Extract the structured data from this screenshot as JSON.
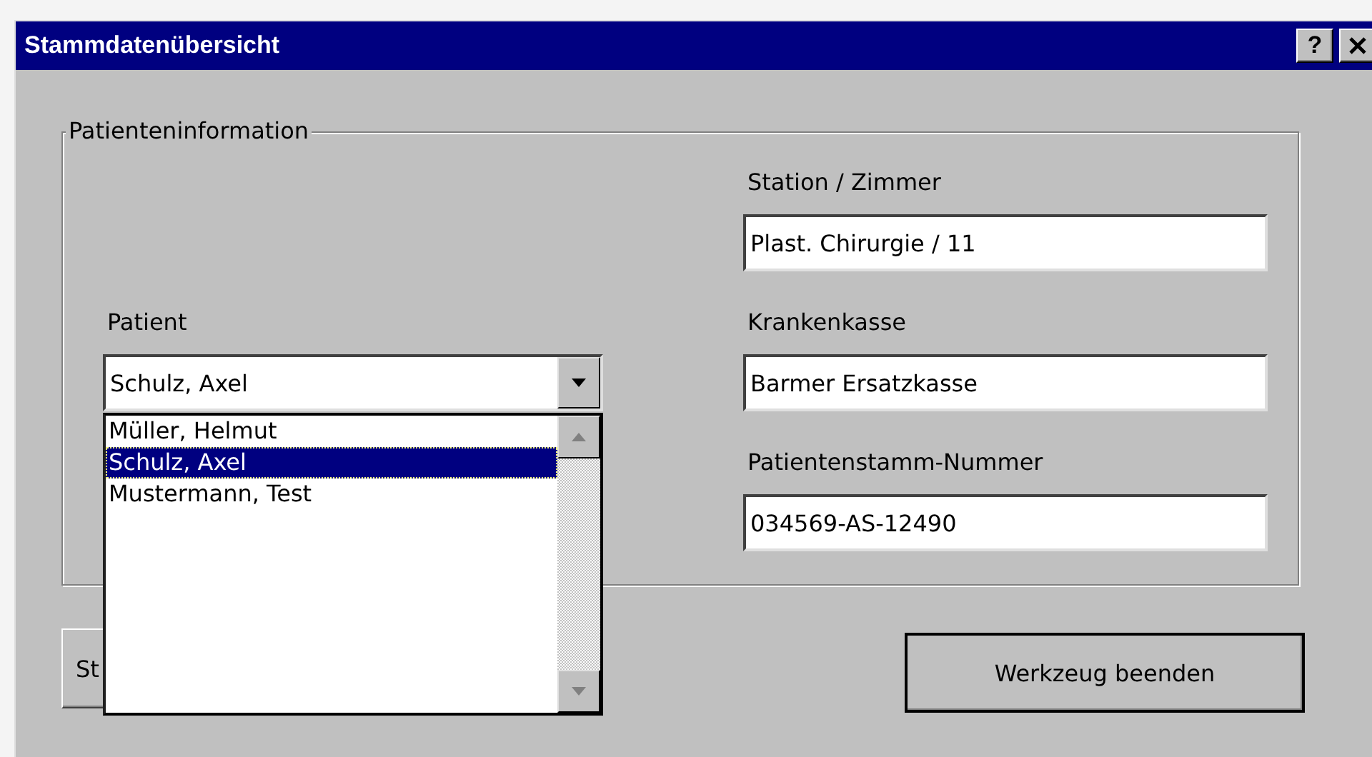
{
  "window": {
    "title": "Stammdatenübersicht",
    "help_label": "?"
  },
  "group": {
    "legend": "Patienteninformation"
  },
  "patient": {
    "label": "Patient",
    "value": "Schulz, Axel",
    "expanded": true,
    "options": [
      {
        "label": "Müller, Helmut",
        "selected": false
      },
      {
        "label": "Schulz, Axel",
        "selected": true
      },
      {
        "label": "Mustermann, Test",
        "selected": false
      }
    ]
  },
  "fields": [
    {
      "label": "Station / Zimmer",
      "value": "Plast. Chirurgie / 11"
    },
    {
      "label": "Krankenkasse",
      "value": "Barmer Ersatzkasse"
    },
    {
      "label": "Patientenstamm-Nummer",
      "value": "034569-AS-12490"
    }
  ],
  "buttons": [
    {
      "label": "St",
      "default": false
    },
    {
      "label": "Werkzeug beenden",
      "default": true
    }
  ]
}
